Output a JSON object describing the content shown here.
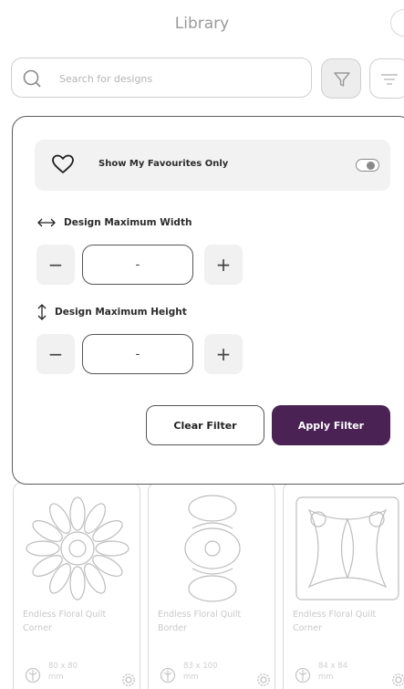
{
  "header": {
    "title": "Library"
  },
  "search": {
    "placeholder": "Search for designs"
  },
  "filter": {
    "favourites_label": "Show My Favourites Only",
    "favourites_enabled": false,
    "width": {
      "label": "Design Maximum Width",
      "value": "-",
      "minus": "−",
      "plus": "+"
    },
    "height": {
      "label": "Design Maximum Height",
      "value": "-",
      "minus": "−",
      "plus": "+"
    },
    "clear_label": "Clear Filter",
    "apply_label": "Apply Filter"
  },
  "cards": [
    {
      "name": "Endless Floral Quilt Corner",
      "size": "80 x 80",
      "unit": "mm"
    },
    {
      "name": "Endless Floral Quilt Border",
      "size": "83 x 100",
      "unit": "mm"
    },
    {
      "name": "Endless Floral Quilt Corner",
      "size": "84 x 84",
      "unit": "mm"
    }
  ],
  "colors": {
    "accent": "#4a2254",
    "panel_border": "#5b5b5b",
    "row_bg": "#f2f2f2"
  },
  "icons": [
    "search-icon",
    "filter-icon",
    "sort-icon",
    "heart-icon",
    "width-arrows-icon",
    "height-arrows-icon",
    "hoop-icon",
    "gear-icon"
  ]
}
